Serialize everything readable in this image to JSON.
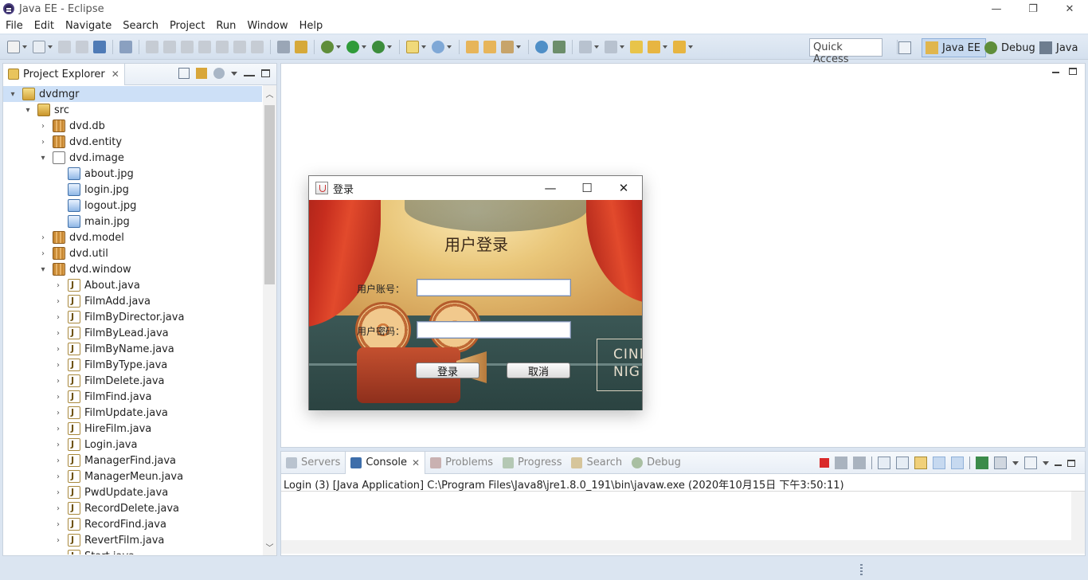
{
  "window": {
    "title": "Java EE - Eclipse",
    "controls": [
      "—",
      "❐",
      "✕"
    ]
  },
  "menu": [
    "File",
    "Edit",
    "Navigate",
    "Search",
    "Project",
    "Run",
    "Window",
    "Help"
  ],
  "toolbar": {
    "quick_access": "Quick Access",
    "perspectives": [
      "Java EE",
      "Debug",
      "Java"
    ]
  },
  "project_explorer": {
    "tab_label": "Project Explorer",
    "close_glyph": "✕",
    "tree": [
      {
        "label": "dvdmgr",
        "icon": "project-icon",
        "expander": "▾"
      },
      {
        "label": "src",
        "icon": "source-folder-icon",
        "expander": "▾"
      },
      {
        "label": "dvd.db",
        "icon": "package-icon",
        "expander": "›"
      },
      {
        "label": "dvd.entity",
        "icon": "package-icon",
        "expander": "›"
      },
      {
        "label": "dvd.image",
        "icon": "empty-package-icon",
        "expander": "▾"
      },
      {
        "label": "about.jpg",
        "icon": "jpg-file-icon",
        "expander": ""
      },
      {
        "label": "login.jpg",
        "icon": "jpg-file-icon",
        "expander": ""
      },
      {
        "label": "logout.jpg",
        "icon": "jpg-file-icon",
        "expander": ""
      },
      {
        "label": "main.jpg",
        "icon": "jpg-file-icon",
        "expander": ""
      },
      {
        "label": "dvd.model",
        "icon": "package-icon",
        "expander": "›"
      },
      {
        "label": "dvd.util",
        "icon": "package-icon",
        "expander": "›"
      },
      {
        "label": "dvd.window",
        "icon": "package-icon",
        "expander": "▾"
      },
      {
        "label": "About.java",
        "icon": "java-file-icon",
        "expander": "›"
      },
      {
        "label": "FilmAdd.java",
        "icon": "java-file-icon",
        "expander": "›"
      },
      {
        "label": "FilmByDirector.java",
        "icon": "java-file-icon",
        "expander": "›"
      },
      {
        "label": "FilmByLead.java",
        "icon": "java-file-icon",
        "expander": "›"
      },
      {
        "label": "FilmByName.java",
        "icon": "java-file-icon",
        "expander": "›"
      },
      {
        "label": "FilmByType.java",
        "icon": "java-file-icon",
        "expander": "›"
      },
      {
        "label": "FilmDelete.java",
        "icon": "java-file-icon",
        "expander": "›"
      },
      {
        "label": "FilmFind.java",
        "icon": "java-file-icon",
        "expander": "›"
      },
      {
        "label": "FilmUpdate.java",
        "icon": "java-file-icon",
        "expander": "›"
      },
      {
        "label": "HireFilm.java",
        "icon": "java-file-icon",
        "expander": "›"
      },
      {
        "label": "Login.java",
        "icon": "java-file-icon",
        "expander": "›"
      },
      {
        "label": "ManagerFind.java",
        "icon": "java-file-icon",
        "expander": "›"
      },
      {
        "label": "ManagerMeun.java",
        "icon": "java-file-icon",
        "expander": "›"
      },
      {
        "label": "PwdUpdate.java",
        "icon": "java-file-icon",
        "expander": "›"
      },
      {
        "label": "RecordDelete.java",
        "icon": "java-file-icon",
        "expander": "›"
      },
      {
        "label": "RecordFind.java",
        "icon": "java-file-icon",
        "expander": "›"
      },
      {
        "label": "RevertFilm.java",
        "icon": "java-file-icon",
        "expander": "›"
      },
      {
        "label": "Start.java",
        "icon": "java-file-icon",
        "expander": "›"
      }
    ]
  },
  "console_view": {
    "tabs": [
      "Servers",
      "Console",
      "Problems",
      "Progress",
      "Search",
      "Debug"
    ],
    "active_tab": "Console",
    "close_glyph": "✕",
    "status_line": "Login (3) [Java Application] C:\\Program Files\\Java8\\jre1.8.0_191\\bin\\javaw.exe (2020年10月15日 下午3:50:11)"
  },
  "login_dialog": {
    "title": "登录",
    "heading": "用户登录",
    "account_label": "用户账号：",
    "password_label": "用户密码：",
    "account_value": "",
    "password_value": "",
    "login_button": "登录",
    "cancel_button": "取消",
    "sign_text_line1": "CINE",
    "sign_text_line2": "NIG",
    "controls": [
      "—",
      "☐",
      "✕"
    ]
  },
  "colors": {
    "accent": "#3b74c4",
    "toolbar_bg": "#dbe5f1",
    "selection": "#cde0f7"
  }
}
